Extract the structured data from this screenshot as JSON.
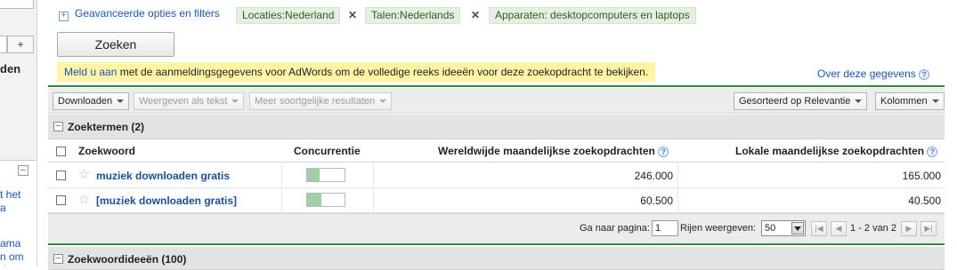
{
  "sidebar": {
    "plus_label": "+",
    "heading_fragment": "den",
    "link_fragments": [
      "t het",
      "a",
      "ama",
      "n om",
      "dt"
    ]
  },
  "filters": {
    "advanced_label": "Geavanceerde opties en filters",
    "chips": [
      {
        "label": "Locaties:Nederland",
        "removable": true
      },
      {
        "label": "Talen:Nederlands",
        "removable": true
      },
      {
        "label": "Apparaten: desktopcomputers en laptops",
        "removable": false
      }
    ],
    "remove_glyph": "✕"
  },
  "search": {
    "button_label": "Zoeken"
  },
  "notice": {
    "link_text": "Meld u aan",
    "text": " met de aanmeldingsgegevens voor AdWords om de volledige reeks ideeën voor deze zoekopdracht te bekijken."
  },
  "about_link": "Over deze gegevens",
  "toolbar": {
    "download": "Downloaden",
    "view_as_text": "Weergeven als tekst",
    "more_similar": "Meer soortgelijke resultaten",
    "sort": "Gesorteerd op Relevantie",
    "columns": "Kolommen"
  },
  "sections": {
    "search_terms": "Zoektermen (2)",
    "keyword_ideas": "Zoekwoordideeën (100)"
  },
  "table": {
    "headers": {
      "keyword": "Zoekwoord",
      "competition": "Concurrentie",
      "global": "Wereldwijde maandelijkse zoekopdrachten",
      "local": "Lokale maandelijkse zoekopdrachten"
    },
    "rows": [
      {
        "keyword": "muziek downloaden gratis",
        "competition": 0.33,
        "global": "246.000",
        "local": "165.000"
      },
      {
        "keyword": "[muziek downloaden gratis]",
        "competition": 0.38,
        "global": "60.500",
        "local": "40.500"
      }
    ]
  },
  "pager": {
    "goto_label": "Ga naar pagina:",
    "page_value": "1",
    "rows_label": "Rijen weergeven:",
    "rows_value": "50",
    "range_text": "1 - 2 van 2"
  },
  "colors": {
    "accent_green": "#2f8a3a",
    "chip_bg": "#e4f1e0",
    "notice_bg": "#fff3a5",
    "link_blue": "#1a55c0",
    "competition_fill": "#9fd0a4"
  }
}
